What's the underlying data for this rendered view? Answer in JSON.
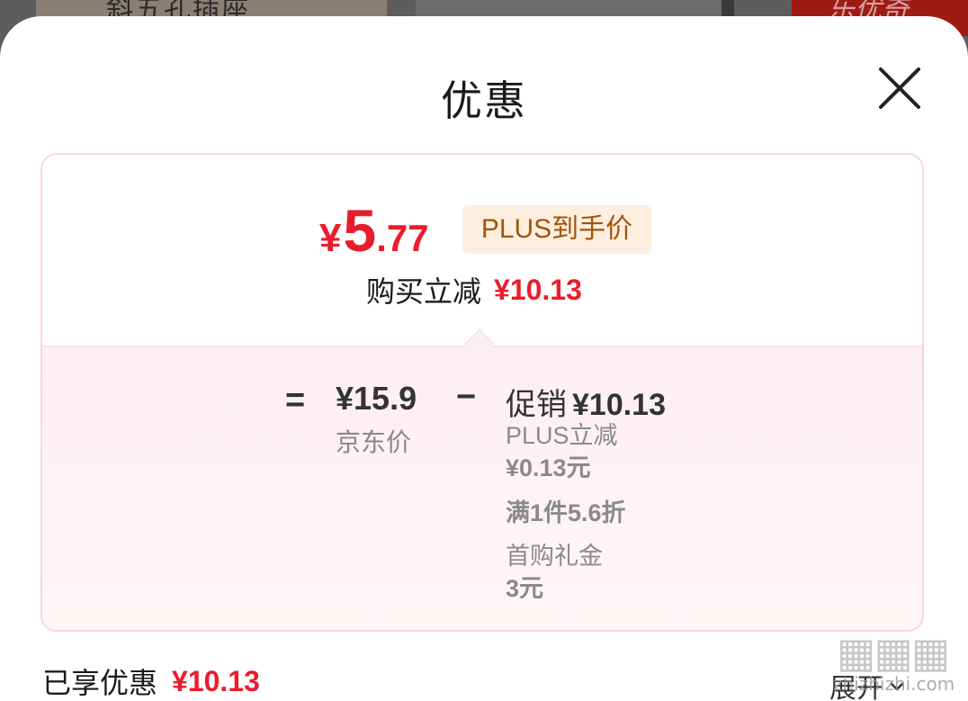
{
  "background": {
    "left_text": "斜五孔插座",
    "right_text": "乐优奇"
  },
  "sheet": {
    "title": "优惠",
    "close_icon": "close-icon"
  },
  "price": {
    "currency": "¥",
    "integer": "5",
    "decimal": ".77",
    "badge": "PLUS到手价"
  },
  "reduce": {
    "label": "购买立减",
    "amount": "¥10.13"
  },
  "formula": {
    "equals": "=",
    "minus": "−",
    "jd_price_value": "¥15.9",
    "jd_price_label": "京东价",
    "promo_title": "促销",
    "promo_amount": "¥10.13",
    "promo_items": [
      {
        "line1": "PLUS立减",
        "line2": "¥0.13元"
      },
      {
        "line1": "满1件5.6折",
        "line2": ""
      },
      {
        "line1": "首购礼金",
        "line2": "3元"
      }
    ]
  },
  "footer": {
    "enjoyed_label": "已享优惠",
    "enjoyed_amount": "¥10.13",
    "expand_label": "展开",
    "watermark_text": "zhizhizhi.com"
  },
  "colors": {
    "accent_red": "#ea1c2c",
    "badge_bg": "#fdeee0",
    "badge_text": "#a25407",
    "card_border": "#fbd5dd"
  }
}
